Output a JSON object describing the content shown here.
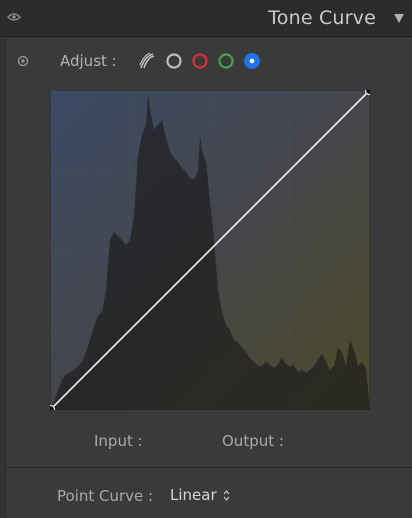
{
  "header": {
    "title": "Tone Curve",
    "visibility_icon": "eye-icon",
    "collapse_icon": "triangle-down-icon"
  },
  "adjust": {
    "label": "Adjust :",
    "target_icon": "target-adjust-icon",
    "channels": [
      {
        "name": "parametric",
        "icon": "parametric-curve-icon",
        "color": "#bdbdbd",
        "selected": false
      },
      {
        "name": "rgb",
        "icon": "rgb-channel-icon",
        "color": "#bdbdbd",
        "selected": false
      },
      {
        "name": "red",
        "icon": "red-channel-icon",
        "color": "#d8323a",
        "selected": false
      },
      {
        "name": "green",
        "icon": "green-channel-icon",
        "color": "#3fa34d",
        "selected": false
      },
      {
        "name": "blue",
        "icon": "blue-channel-icon",
        "color": "#1e74e8",
        "selected": true
      }
    ]
  },
  "curve": {
    "channel": "blue",
    "points": [
      [
        0,
        0
      ],
      [
        255,
        255
      ]
    ],
    "colors": {
      "top_left": "#3c4a66",
      "bottom_right": "#4d4a28",
      "line": "#f0f0f0"
    }
  },
  "readout": {
    "input_label": "Input :",
    "output_label": "Output :"
  },
  "point_curve": {
    "label": "Point Curve :",
    "value": "Linear"
  }
}
